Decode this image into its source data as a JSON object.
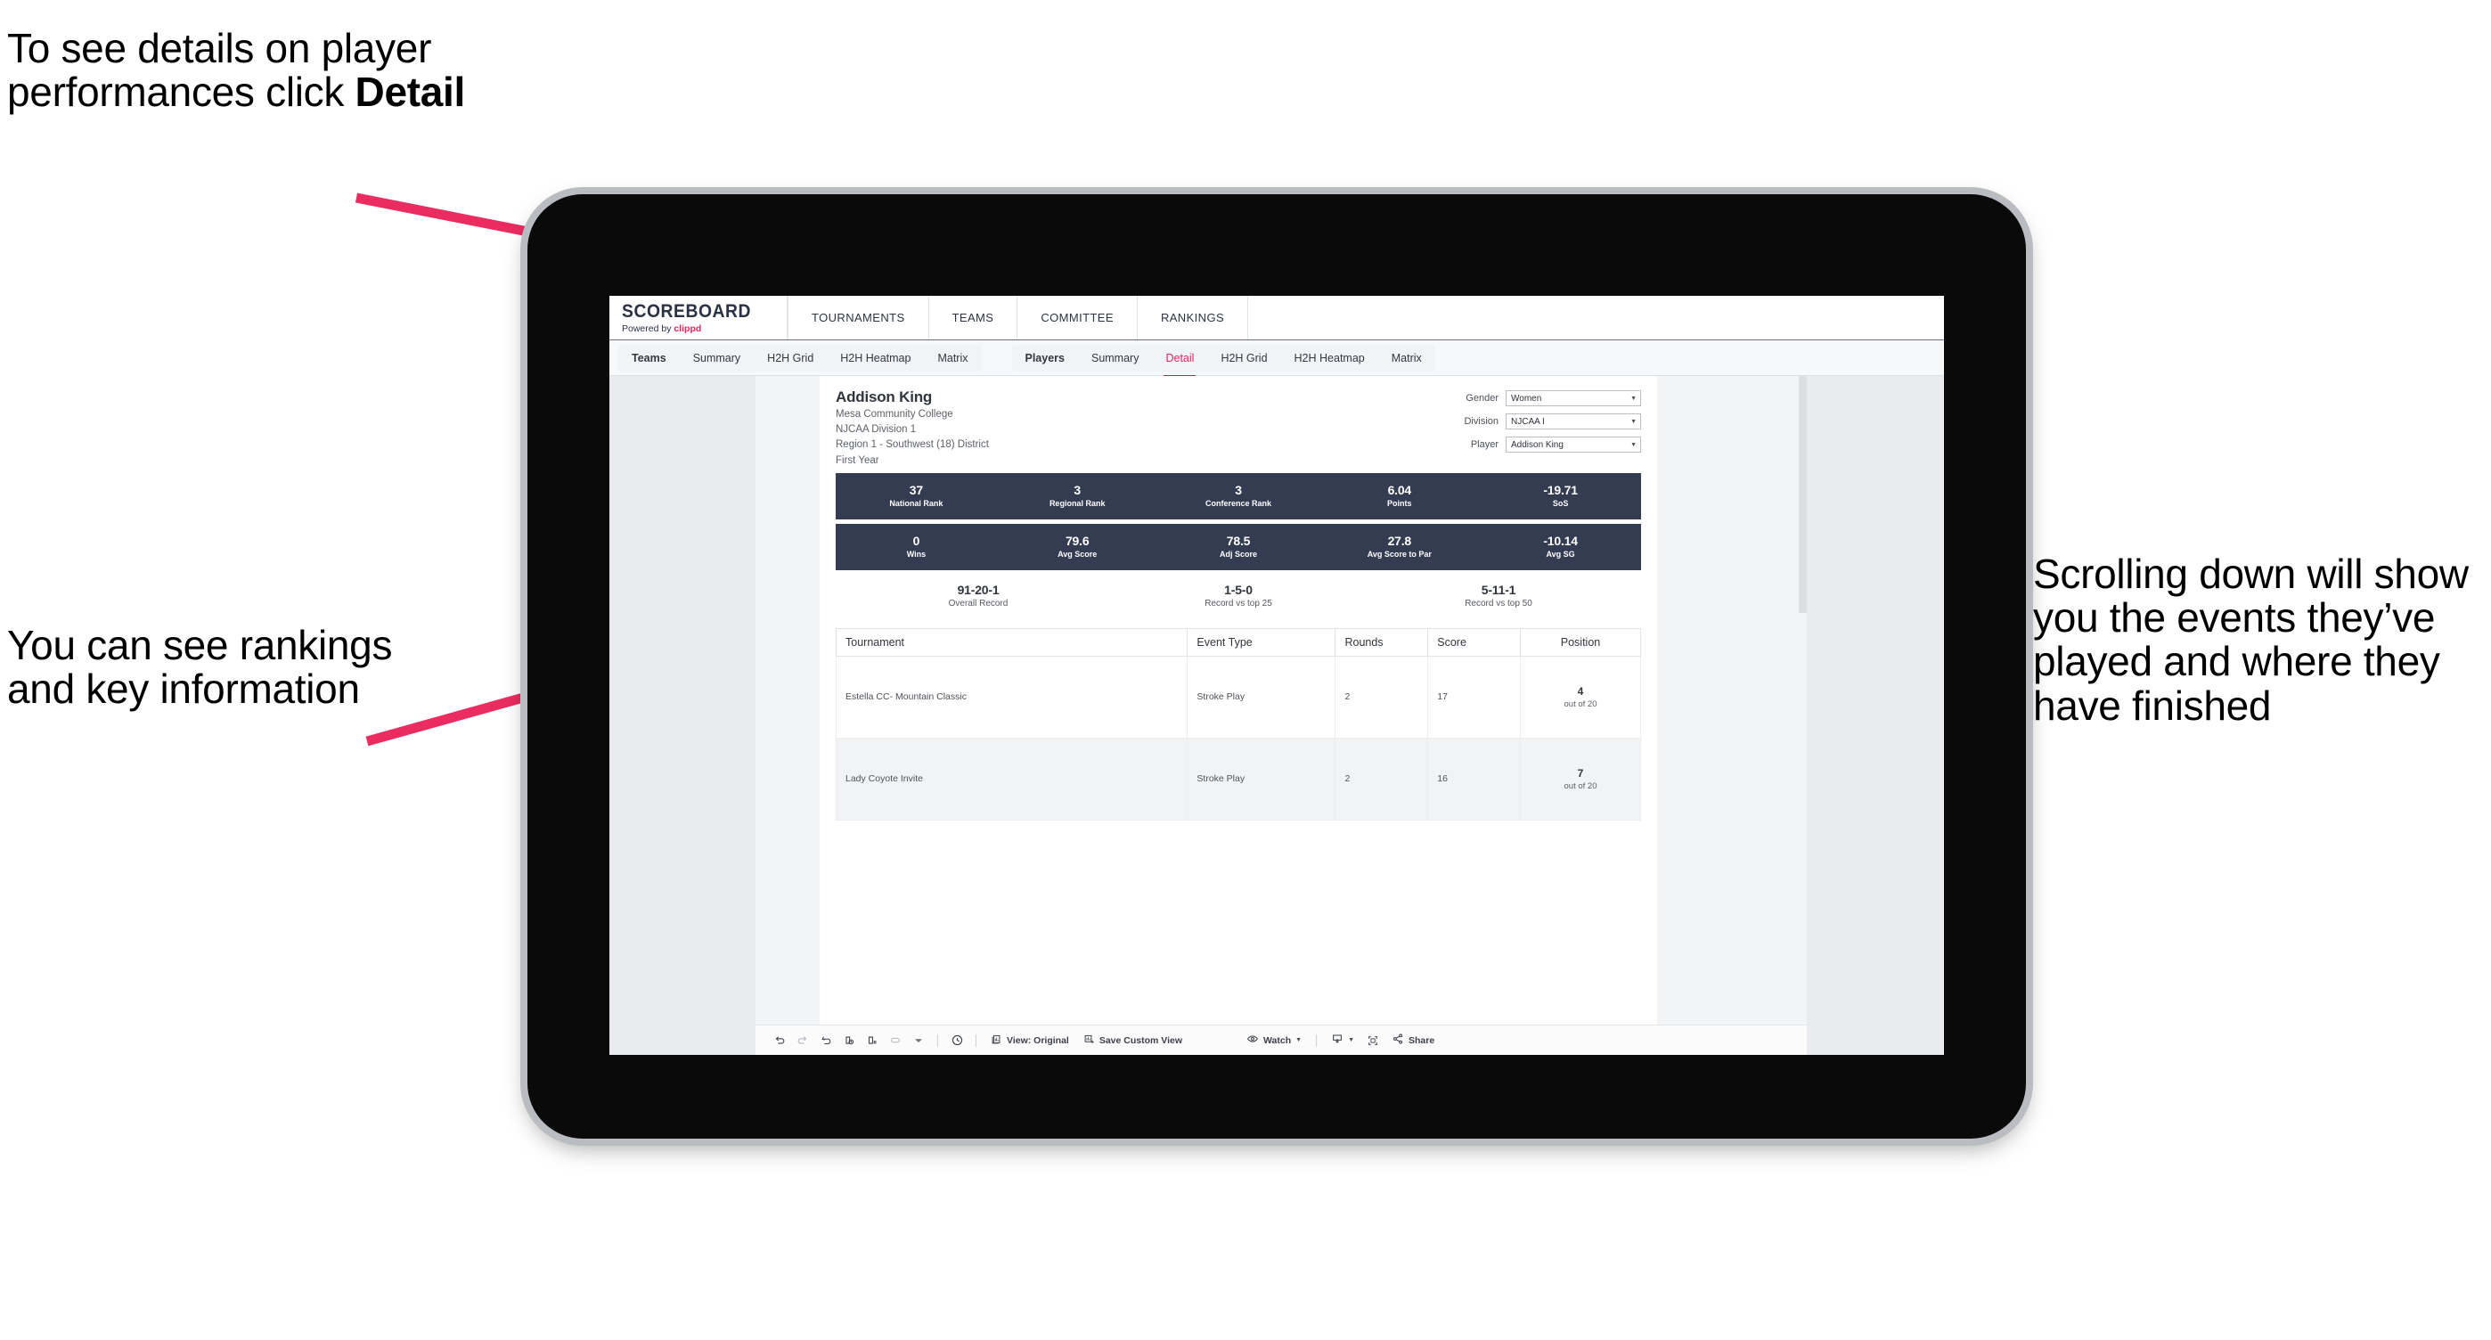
{
  "annotations": [
    {
      "id": "detail",
      "text_before": "To see details on player performances click ",
      "text_bold": "Detail"
    },
    {
      "id": "rankings",
      "text": "You can see rankings and key information"
    },
    {
      "id": "scroll",
      "text": "Scrolling down will show you the events they’ve played and where they have finished"
    }
  ],
  "accent_pink": "#ea2c60",
  "app": {
    "brand": {
      "title": "SCOREBOARD",
      "powered_prefix": "Powered by ",
      "powered_name": "clippd"
    },
    "topnav": [
      {
        "label": "TOURNAMENTS"
      },
      {
        "label": "TEAMS"
      },
      {
        "label": "COMMITTEE"
      },
      {
        "label": "RANKINGS"
      }
    ],
    "subnav_teams": [
      {
        "label": "Teams",
        "strong": true,
        "active": false
      },
      {
        "label": "Summary",
        "strong": false,
        "active": false
      },
      {
        "label": "H2H Grid",
        "strong": false,
        "active": false
      },
      {
        "label": "H2H Heatmap",
        "strong": false,
        "active": false
      },
      {
        "label": "Matrix",
        "strong": false,
        "active": false
      }
    ],
    "subnav_players": [
      {
        "label": "Players",
        "strong": true,
        "active": false
      },
      {
        "label": "Summary",
        "strong": false,
        "active": false
      },
      {
        "label": "Detail",
        "strong": false,
        "active": true
      },
      {
        "label": "H2H Grid",
        "strong": false,
        "active": false
      },
      {
        "label": "H2H Heatmap",
        "strong": false,
        "active": false
      },
      {
        "label": "Matrix",
        "strong": false,
        "active": false
      }
    ],
    "player": {
      "name": "Addison King",
      "school": "Mesa Community College",
      "division": "NJCAA Division 1",
      "region": "Region 1 - Southwest (18) District",
      "year": "First Year"
    },
    "filters": [
      {
        "label": "Gender",
        "value": "Women"
      },
      {
        "label": "Division",
        "value": "NJCAA I"
      },
      {
        "label": "Player",
        "value": "Addison King"
      }
    ],
    "stat_rows": [
      [
        {
          "value": "37",
          "label": "National Rank"
        },
        {
          "value": "3",
          "label": "Regional Rank"
        },
        {
          "value": "3",
          "label": "Conference Rank"
        },
        {
          "value": "6.04",
          "label": "Points"
        },
        {
          "value": "-19.71",
          "label": "SoS"
        }
      ],
      [
        {
          "value": "0",
          "label": "Wins"
        },
        {
          "value": "79.6",
          "label": "Avg Score"
        },
        {
          "value": "78.5",
          "label": "Adj Score"
        },
        {
          "value": "27.8",
          "label": "Avg Score to Par"
        },
        {
          "value": "-10.14",
          "label": "Avg SG"
        }
      ]
    ],
    "records": [
      {
        "value": "91-20-1",
        "label": "Overall Record"
      },
      {
        "value": "1-5-0",
        "label": "Record vs top 25"
      },
      {
        "value": "5-11-1",
        "label": "Record vs top 50"
      }
    ],
    "events_table": {
      "columns": [
        "Tournament",
        "Event Type",
        "Rounds",
        "Score",
        "Position"
      ],
      "rows": [
        {
          "tournament": "Estella CC- Mountain Classic",
          "event_type": "Stroke Play",
          "rounds": "2",
          "score": "17",
          "position_num": "4",
          "position_sub": "out of 20"
        },
        {
          "tournament": "Lady Coyote Invite",
          "event_type": "Stroke Play",
          "rounds": "2",
          "score": "16",
          "position_num": "7",
          "position_sub": "out of 20"
        }
      ]
    },
    "bottombar": {
      "icons": [
        "undo-icon",
        "redo-icon",
        "revert-icon",
        "refresh-data-icon",
        "pause-auto-update-icon",
        "shape-icon",
        "dropdown-caret-icon"
      ],
      "alert_icon": "alert-clock-icon",
      "view_label": "View: Original",
      "view_icon": "view-original-icon",
      "save_label": "Save Custom View",
      "save_icon": "save-custom-view-icon",
      "watch_label": "Watch",
      "watch_icon": "eye-icon",
      "download_icon": "download-icon",
      "fullscreen_icon": "fullscreen-icon",
      "share_label": "Share",
      "share_icon": "share-icon"
    }
  }
}
